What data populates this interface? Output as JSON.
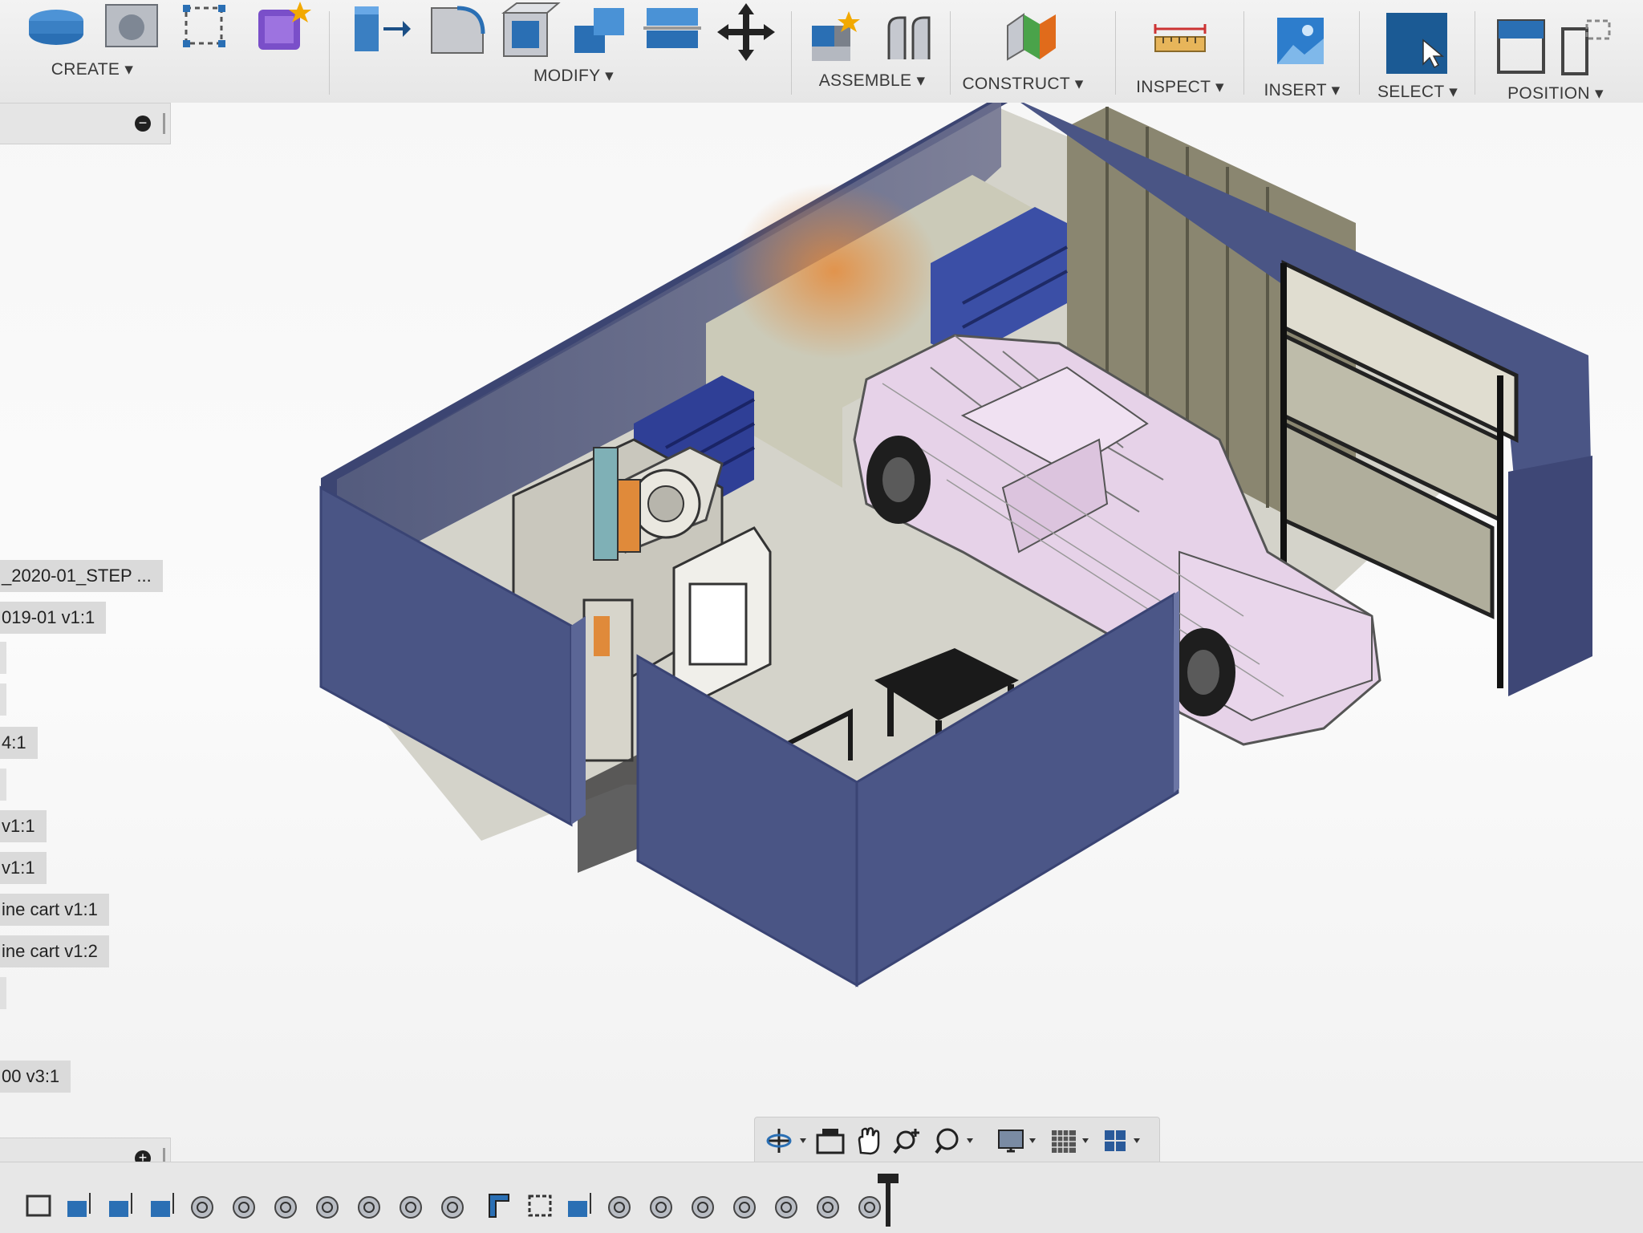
{
  "toolbar": {
    "groups": [
      {
        "label": "CREATE ▾"
      },
      {
        "label": "MODIFY ▾"
      },
      {
        "label": "ASSEMBLE ▾"
      },
      {
        "label": "CONSTRUCT ▾"
      },
      {
        "label": "INSPECT ▾"
      },
      {
        "label": "INSERT ▾"
      },
      {
        "label": "SELECT ▾"
      },
      {
        "label": "POSITION ▾"
      }
    ]
  },
  "browser": {
    "items": [
      {
        "label": "_2020-01_STEP ..."
      },
      {
        "label": "019-01 v1:1"
      },
      {
        "label": "4:1"
      },
      {
        "label": "v1:1"
      },
      {
        "label": "v1:1"
      },
      {
        "label": "ine cart v1:1"
      },
      {
        "label": "ine cart v1:2"
      },
      {
        "label": "00 v3:1"
      }
    ]
  },
  "comments_panel": {
    "add_symbol": "+"
  },
  "browser_panel": {
    "collapse_symbol": "−"
  },
  "navbar": {
    "tools": [
      "orbit-icon",
      "look-at-icon",
      "pan-icon",
      "zoom-icon",
      "fit-icon",
      "display-settings-icon",
      "grid-settings-icon",
      "viewports-icon"
    ]
  },
  "colors": {
    "wall": "#4a5585",
    "wall_inner": "#5a6290",
    "floor": "#d4d3ca",
    "truck": "#e6d2e8",
    "select_accent": "#1b5a94"
  }
}
